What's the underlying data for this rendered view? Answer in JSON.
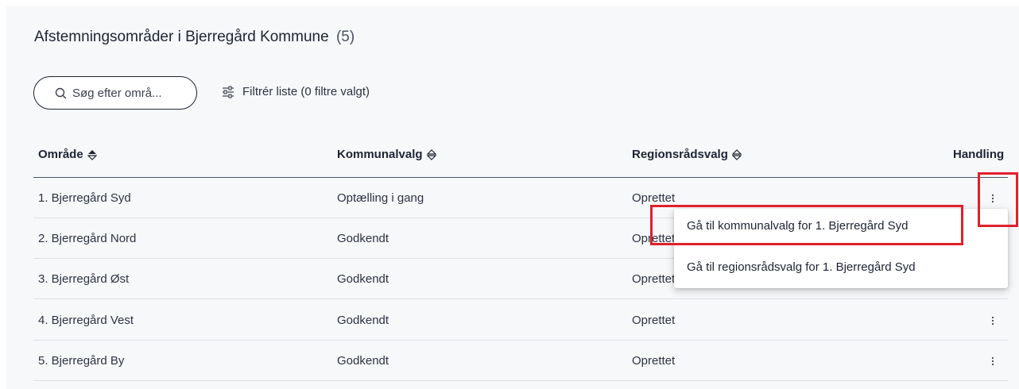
{
  "header": {
    "title": "Afstemningsområder i Bjerregård Kommune",
    "count": "(5)"
  },
  "search": {
    "placeholder": "Søg efter områ..."
  },
  "filter": {
    "label": "Filtrér liste (0 filtre valgt)"
  },
  "table": {
    "columns": [
      "Område",
      "Kommunalvalg",
      "Regionsrådsvalg",
      "Handling"
    ],
    "rows": [
      {
        "area": "1. Bjerregård Syd",
        "kommunalvalg": "Optælling i gang",
        "regionsraadsvalg": "Oprettet"
      },
      {
        "area": "2. Bjerregård Nord",
        "kommunalvalg": "Godkendt",
        "regionsraadsvalg": "Oprettet"
      },
      {
        "area": "3. Bjerregård Øst",
        "kommunalvalg": "Godkendt",
        "regionsraadsvalg": "Oprettet"
      },
      {
        "area": "4. Bjerregård Vest",
        "kommunalvalg": "Godkendt",
        "regionsraadsvalg": "Oprettet"
      },
      {
        "area": "5. Bjerregård By",
        "kommunalvalg": "Godkendt",
        "regionsraadsvalg": "Oprettet"
      }
    ]
  },
  "action_menu": {
    "items": [
      "Gå til kommunalvalg for 1. Bjerregård Syd",
      "Gå til regionsrådsvalg for 1. Bjerregård Syd"
    ]
  },
  "colors": {
    "highlight": "#e0202b",
    "text": "#1d2433",
    "border": "#dde0e6"
  }
}
